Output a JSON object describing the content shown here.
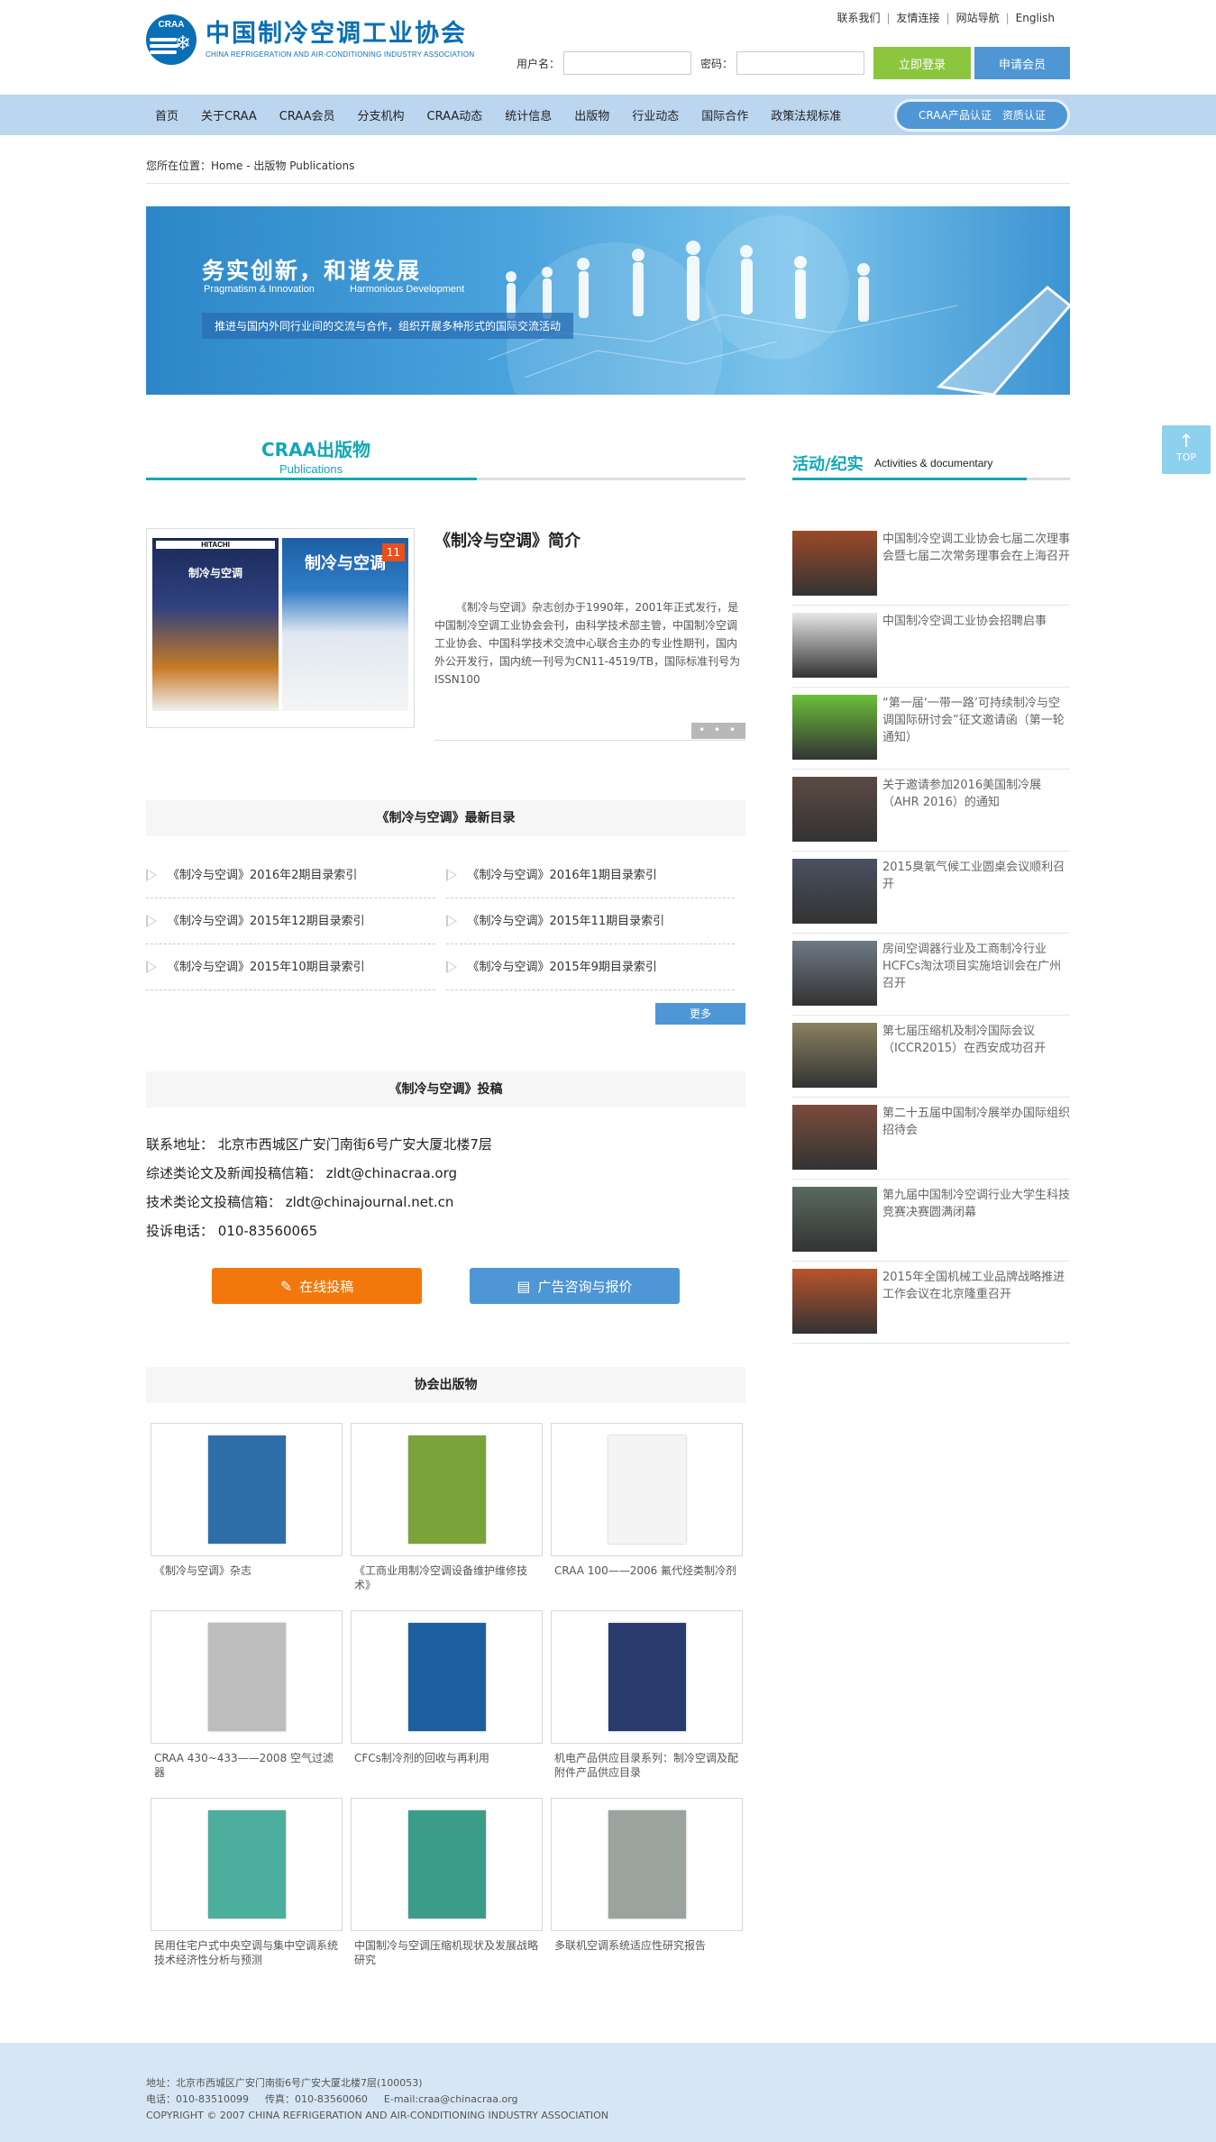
{
  "header": {
    "org_name_cn": "中国制冷空调工业协会",
    "org_name_en": "CHINA REFRIGERATION AND AIR-CONDITIONING INDUSTRY ASSOCIATION",
    "logo_abbr": "CRAA",
    "top_links": [
      "联系我们",
      "友情连接",
      "网站导航",
      "English"
    ],
    "username_label": "用户名：",
    "password_label": "密码：",
    "login_button": "立即登录",
    "apply_button": "申请会员"
  },
  "nav": {
    "items": [
      "首页",
      "关于CRAA",
      "CRAA会员",
      "分支机构",
      "CRAA动态",
      "统计信息",
      "出版物",
      "行业动态",
      "国际合作",
      "政策法规标准"
    ],
    "cert_links": [
      "CRAA产品认证",
      "资质认证"
    ]
  },
  "breadcrumb": "您所在位置：Home - 出版物 Publications",
  "banner": {
    "headline": "务实创新，和谐发展",
    "sub_left": "Pragmatism & Innovation",
    "sub_right": "Harmonious Development",
    "strip": "推进与国内外同行业间的交流与合作，组织开展多种形式的国际交流活动"
  },
  "publications_section": {
    "title": "CRAA出版物",
    "title_en": "Publications",
    "intro_title": "《制冷与空调》简介",
    "intro_body": "《制冷与空调》杂志创办于1990年，2001年正式发行，是中国制冷空调工业协会会刊，由科学技术部主管，中国制冷空调工业协会、中国科学技术交流中心联合主办的专业性期刊，国内外公开发行，国内统一刊号为CN11-4519/TB，国际标准刊号为ISSN100",
    "covers": [
      {
        "brand": "HITACHI",
        "masthead": "制冷与空调",
        "issue": ""
      },
      {
        "brand": "",
        "masthead": "制冷与空调",
        "issue": "11"
      }
    ],
    "more_dots": "• • •"
  },
  "toc": {
    "title": "《制冷与空调》最新目录",
    "items": [
      "《制冷与空调》2016年2期目录索引",
      "《制冷与空调》2016年1期目录索引",
      "《制冷与空调》2015年12期目录索引",
      "《制冷与空调》2015年11期目录索引",
      "《制冷与空调》2015年10期目录索引",
      "《制冷与空调》2015年9期目录索引"
    ],
    "more_label": "更多"
  },
  "contribute": {
    "title": "《制冷与空调》投稿",
    "lines": [
      "联系地址： 北京市西城区广安门南街6号广安大厦北楼7层",
      "综述类论文及新闻投稿信箱： zldt@chinacraa.org",
      "技术类论文投稿信箱： zldt@chinajournal.net.cn",
      "投诉电话： 010-83560065"
    ],
    "online_button": "在线投稿",
    "ad_button": "广告咨询与报价"
  },
  "association_pubs": {
    "title": "协会出版物",
    "items": [
      {
        "caption": "《制冷与空调》杂志",
        "color": "#2e6ea8"
      },
      {
        "caption": "《工商业用制冷空调设备维护维修技术》",
        "color": "#7aa33a"
      },
      {
        "caption": "CRAA 100——2006 氟代烃类制冷剂",
        "color": "#f4f4f4"
      },
      {
        "caption": "CRAA 430~433——2008 空气过滤器",
        "color": "#bdbdbd"
      },
      {
        "caption": "CFCs制冷剂的回收与再利用",
        "color": "#1c5fa0"
      },
      {
        "caption": "机电产品供应目录系列：制冷空调及配附件产品供应目录",
        "color": "#2a3c6e"
      },
      {
        "caption": "民用住宅户式中央空调与集中空调系统技术经济性分析与预测",
        "color": "#4cae9c"
      },
      {
        "caption": "中国制冷与空调压缩机现状及发展战略研究",
        "color": "#3c9c8a"
      },
      {
        "caption": "多联机空调系统适应性研究报告",
        "color": "#9aa39e"
      }
    ]
  },
  "activities": {
    "title": "活动/纪实",
    "title_en": "Activities & documentary",
    "items": [
      {
        "text": "中国制冷空调工业协会七届二次理事会暨七届二次常务理事会在上海召开",
        "color": "#9b4a28"
      },
      {
        "text": "中国制冷空调工业协会招聘启事",
        "color": "#e6e6e6"
      },
      {
        "text": "“第一届‘一带一路’可持续制冷与空调国际研讨会”征文邀请函（第一轮通知）",
        "color": "#6bbf3a"
      },
      {
        "text": "关于邀请参加2016美国制冷展（AHR 2016）的通知",
        "color": "#5c4a44"
      },
      {
        "text": "2015臭氧气候工业圆桌会议顺利召开",
        "color": "#4a5160"
      },
      {
        "text": "房间空调器行业及工商制冷行业HCFCs淘汰项目实施培训会在广州召开",
        "color": "#6f7a86"
      },
      {
        "text": "第七届压缩机及制冷国际会议（ICCR2015）在西安成功召开",
        "color": "#8a8160"
      },
      {
        "text": "第二十五届中国制冷展举办国际组织招待会",
        "color": "#7a4c3c"
      },
      {
        "text": "第九届中国制冷空调行业大学生科技竞赛决赛圆满闭幕",
        "color": "#5a6a60"
      },
      {
        "text": "2015年全国机械工业品牌战略推进工作会议在北京隆重召开",
        "color": "#b8542c"
      }
    ]
  },
  "to_top": "TOP",
  "footer": {
    "address": "地址：北京市西城区广安门南街6号广安大厦北楼7层(100053)",
    "phone": "电话：010-83510099",
    "fax": "传真：010-83560060",
    "email": "E-mail:craa@chinacraa.org",
    "copyright": "COPYRIGHT © 2007 CHINA REFRIGERATION AND AIR-CONDITIONING INDUSTRY ASSOCIATION"
  },
  "colors": {
    "brand_blue": "#0b6fb6",
    "accent_teal": "#12a7b6",
    "nav_bg": "#bcd6ef",
    "login_green": "#8cc63f",
    "button_blue": "#4f96d5",
    "button_orange": "#f2780c"
  }
}
